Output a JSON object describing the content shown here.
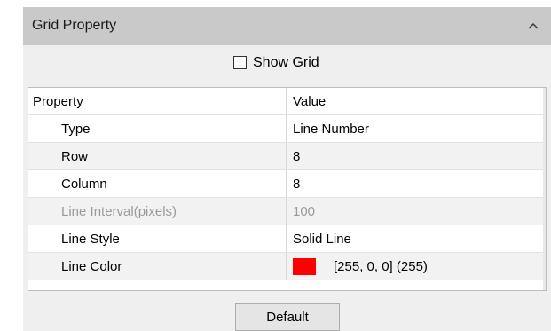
{
  "panel": {
    "title": "Grid Property",
    "collapse_icon": "chevron-up-icon"
  },
  "show_grid": {
    "label": "Show Grid",
    "checked": false
  },
  "grid": {
    "columns": [
      "Property",
      "Value"
    ],
    "rows": [
      {
        "property": "Type",
        "value": "Line Number",
        "enabled": true
      },
      {
        "property": "Row",
        "value": "8",
        "enabled": true
      },
      {
        "property": "Column",
        "value": "8",
        "enabled": true
      },
      {
        "property": "Line Interval(pixels)",
        "value": "100",
        "enabled": false
      },
      {
        "property": "Line Style",
        "value": "Solid Line",
        "enabled": true
      },
      {
        "property": "Line Color",
        "value": "[255, 0, 0] (255)",
        "enabled": true,
        "swatch_color": "#ff0000"
      }
    ]
  },
  "default_button": {
    "label": "Default"
  }
}
